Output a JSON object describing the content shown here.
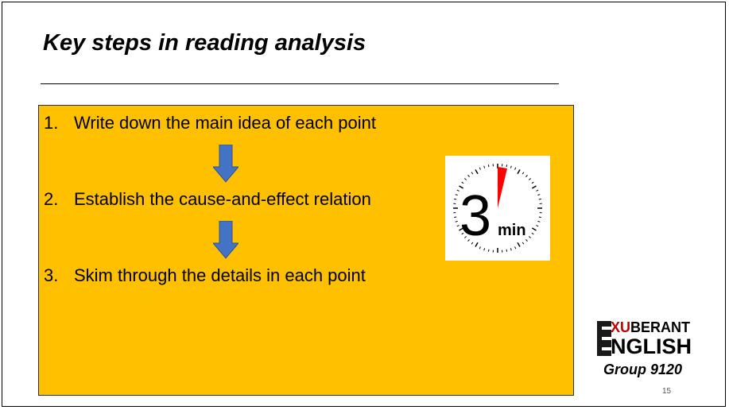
{
  "slide": {
    "title": "Key steps in reading analysis",
    "page_number": "15"
  },
  "steps": [
    {
      "number": "1.",
      "text": "Write down the main idea of each point"
    },
    {
      "number": "2.",
      "text": "Establish the cause-and-effect relation"
    },
    {
      "number": "3.",
      "text": "Skim through the details in each point"
    }
  ],
  "timer": {
    "value": "3",
    "unit": "min"
  },
  "logo": {
    "line1": "XUBERANT",
    "line2": "NGLISH",
    "accent": "#C00000"
  },
  "group_label": "Group 9120",
  "colors": {
    "panel": "#FFC000",
    "arrow": "#4472C4",
    "timer_wedge": "#FF0000"
  }
}
